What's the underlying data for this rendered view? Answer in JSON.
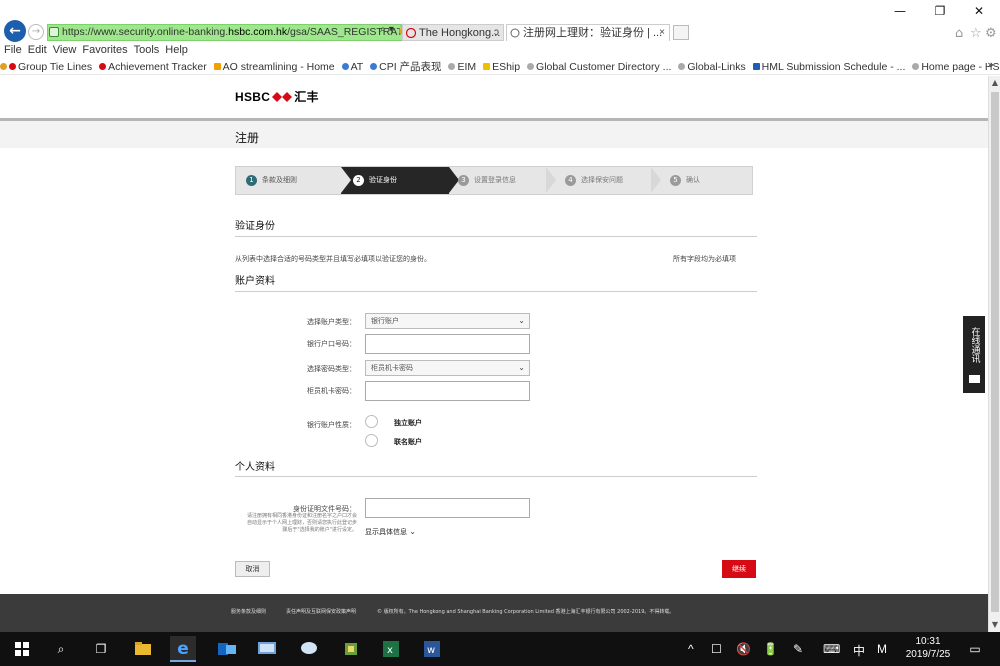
{
  "browser": {
    "address": {
      "prefix": "https://www.security.online-banking.",
      "domain": "hsbc.com.hk",
      "path": "/gsa/SAAS_REGISTRATI"
    },
    "address_tools": "⌕ ▾ 🔒",
    "tabs": [
      {
        "label": "The Hongkong...",
        "close": "ↄ"
      },
      {
        "label": "注册网上理财：验证身份 | ...",
        "close": "×"
      }
    ],
    "menu": [
      "File",
      "Edit",
      "View",
      "Favorites",
      "Tools",
      "Help"
    ],
    "favorites": [
      "Group Tie Lines",
      "Achievement Tracker",
      "AO streamlining - Home",
      "AT",
      "CPI 产品表现",
      "EIM",
      "EShip",
      "Global Customer Directory ...",
      "Global-Links",
      "HML Submission Schedule - ...",
      "Home page - HSBC RMP"
    ],
    "favorites_more": "»",
    "window_controls": {
      "minimize": "—",
      "restore": "❐",
      "close": "✕"
    }
  },
  "page": {
    "logo_text": "HSBC",
    "logo_cn": "汇丰",
    "title": "注册",
    "steps": [
      {
        "num": "1",
        "label": "条款及细则"
      },
      {
        "num": "2",
        "label": "验证身份"
      },
      {
        "num": "3",
        "label": "设置登录信息"
      },
      {
        "num": "4",
        "label": "选择保安问题"
      },
      {
        "num": "5",
        "label": "确认"
      }
    ],
    "verify_heading": "验证身份",
    "instruction": "从列表中选择合适的号码类型并且填写必填项以验证您的身份。",
    "required_note": "所有字段均为必填项",
    "account_section": "账户资料",
    "account_type_label": "选择账户类型：",
    "account_type_value": "银行账户",
    "account_number_label": "银行户口号码：",
    "pin_type_label": "选择密码类型：",
    "pin_type_value": "柜员机卡密码",
    "atm_pin_label": "柜员机卡密码：",
    "account_nature_label": "银行账户性质：",
    "radio_single": "独立账户",
    "radio_joint": "联名账户",
    "personal_section": "个人资料",
    "id_label": "身份证明文件号码：",
    "id_note": "请注册拥有相同香港身份证和注册名字之户口才会自动显示于个人网上理财，否则请您执行此登记步骤后于\"选择我的账户\"进行设定。",
    "show_details": "显示具体信息",
    "cancel": "取消",
    "continue": "继续",
    "footer_links": [
      "服务条款及细则",
      "责任声明及互联网保安政策声明",
      "© 版权所有。The Hongkong and Shanghai Banking Corporation Limited 香港上海汇丰银行有限公司 2002-2019。不得转载。"
    ],
    "chat_widget": "在线通讯"
  },
  "taskbar": {
    "tray": [
      "^",
      "☐",
      "🔇",
      "🔋",
      "✎",
      "⌨",
      "中",
      "M"
    ],
    "time": "10:31",
    "date": "2019/7/25"
  },
  "colors": {
    "address_bg": "#9ee78c",
    "hsbc_red": "#d50a15",
    "step_active": "#262626",
    "footer": "#3b3b3b"
  }
}
